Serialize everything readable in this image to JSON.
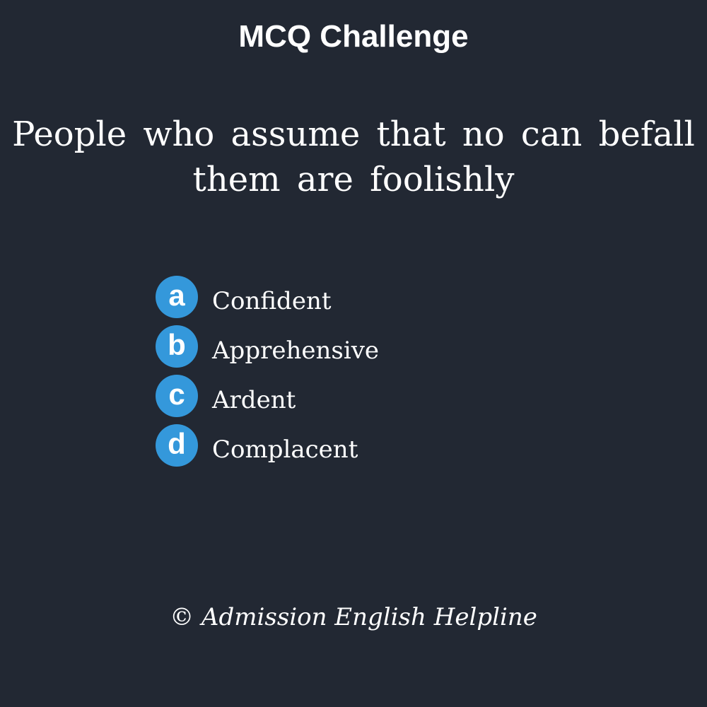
{
  "title": "MCQ Challenge",
  "question": {
    "line1": "People who assume that no can befall",
    "line2": "them are foolishly"
  },
  "options": [
    {
      "letter": "a",
      "text": "Confident"
    },
    {
      "letter": "b",
      "text": "Apprehensive"
    },
    {
      "letter": "c",
      "text": "Ardent"
    },
    {
      "letter": "d",
      "text": "Complacent"
    }
  ],
  "footer": "© Admission English Helpline",
  "colors": {
    "background": "#222833",
    "badge": "#3498db",
    "text": "#ffffff"
  }
}
